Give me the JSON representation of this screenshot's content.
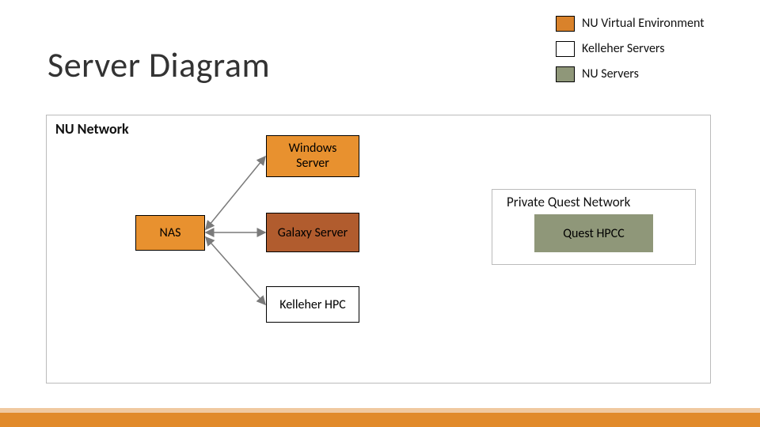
{
  "title": "Server Diagram",
  "legend": {
    "nu_virtual": "NU Virtual Environment",
    "kelleher": "Kelleher Servers",
    "nu_servers": "NU Servers"
  },
  "groups": {
    "nu_network": "NU Network",
    "private_quest": "Private Quest Network"
  },
  "nodes": {
    "nas": "NAS",
    "windows_server": "Windows Server",
    "galaxy_server": "Galaxy Server",
    "kelleher_hpc": "Kelleher HPC",
    "quest_hpcc": "Quest HPCC"
  },
  "colors": {
    "nu_virtual": "#D9822B",
    "kelleher": "#FFFFFF",
    "nu_servers": "#8F9779",
    "accent_bar": "#E18A2A"
  },
  "chart_data": {
    "type": "diagram",
    "title": "Server Diagram",
    "legend": [
      {
        "label": "NU Virtual Environment",
        "color": "#D9822B"
      },
      {
        "label": "Kelleher Servers",
        "color": "#FFFFFF"
      },
      {
        "label": "NU Servers",
        "color": "#8F9779"
      }
    ],
    "groups": [
      {
        "id": "nu_network",
        "label": "NU Network",
        "contains": [
          "nas",
          "windows_server",
          "galaxy_server",
          "kelleher_hpc",
          "private_quest"
        ]
      },
      {
        "id": "private_quest",
        "label": "Private Quest Network",
        "contains": [
          "quest_hpcc"
        ]
      }
    ],
    "nodes": [
      {
        "id": "nas",
        "label": "NAS",
        "category": "NU Virtual Environment"
      },
      {
        "id": "windows_server",
        "label": "Windows Server",
        "category": "NU Virtual Environment"
      },
      {
        "id": "galaxy_server",
        "label": "Galaxy Server",
        "category": "NU Virtual Environment"
      },
      {
        "id": "kelleher_hpc",
        "label": "Kelleher HPC",
        "category": "Kelleher Servers"
      },
      {
        "id": "quest_hpcc",
        "label": "Quest HPCC",
        "category": "NU Servers"
      }
    ],
    "edges": [
      {
        "from": "nas",
        "to": "windows_server",
        "style": "arrow",
        "bidirectional": true
      },
      {
        "from": "nas",
        "to": "galaxy_server",
        "style": "arrow",
        "bidirectional": true
      },
      {
        "from": "nas",
        "to": "kelleher_hpc",
        "style": "arrow",
        "bidirectional": true
      }
    ]
  }
}
